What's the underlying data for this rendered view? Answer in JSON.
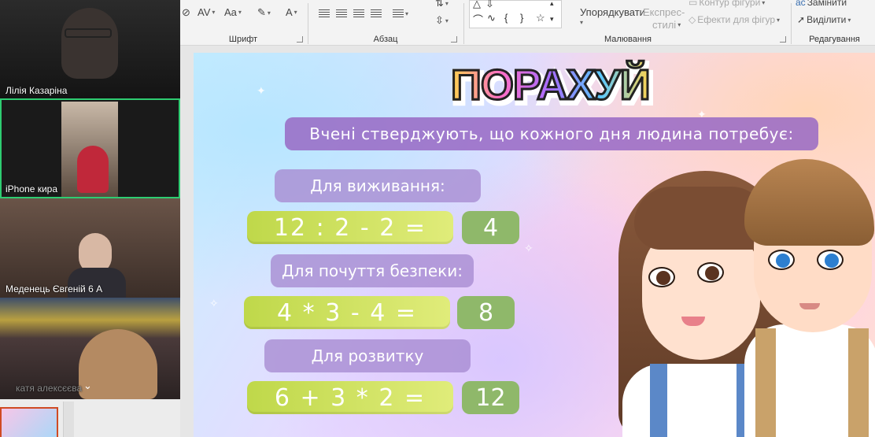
{
  "ribbon": {
    "font_group": "Шрифт",
    "paragraph_group": "Абзац",
    "drawing_group": "Малювання",
    "editing_group": "Редагування",
    "arrange": "Упорядкувати",
    "quick_styles_line1": "Експрес-",
    "quick_styles_line2": "стилі",
    "shape_outline": "Контур фігури",
    "shape_effects": "Ефекти для фігур",
    "replace": "Замінити",
    "select": "Виділити",
    "font_size_icon": "Aa",
    "char_spacing_icon": "AV",
    "font_color_icon": "A"
  },
  "participants": [
    {
      "name": "Лілія Казаріна"
    },
    {
      "name": "iPhone кира"
    },
    {
      "name": "Меденець Євгеній 6 А"
    },
    {
      "name": "катя алексєєва"
    }
  ],
  "slide": {
    "title": "ПОРАХУЙ",
    "subtitle": "Вчені стверджують, що кожного дня людина потребує:",
    "sections": [
      {
        "label": "Для виживання:",
        "equation": "12 : 2 - 2 =",
        "answer": "4"
      },
      {
        "label": "Для почуття безпеки:",
        "equation": "4 * 3 - 4 =",
        "answer": "8"
      },
      {
        "label": "Для розвитку",
        "equation": "6 + 3 * 2 =",
        "answer": "12"
      }
    ]
  },
  "colors": {
    "active_speaker_border": "#2ecc71",
    "thumbnail_border": "#d04a23"
  }
}
